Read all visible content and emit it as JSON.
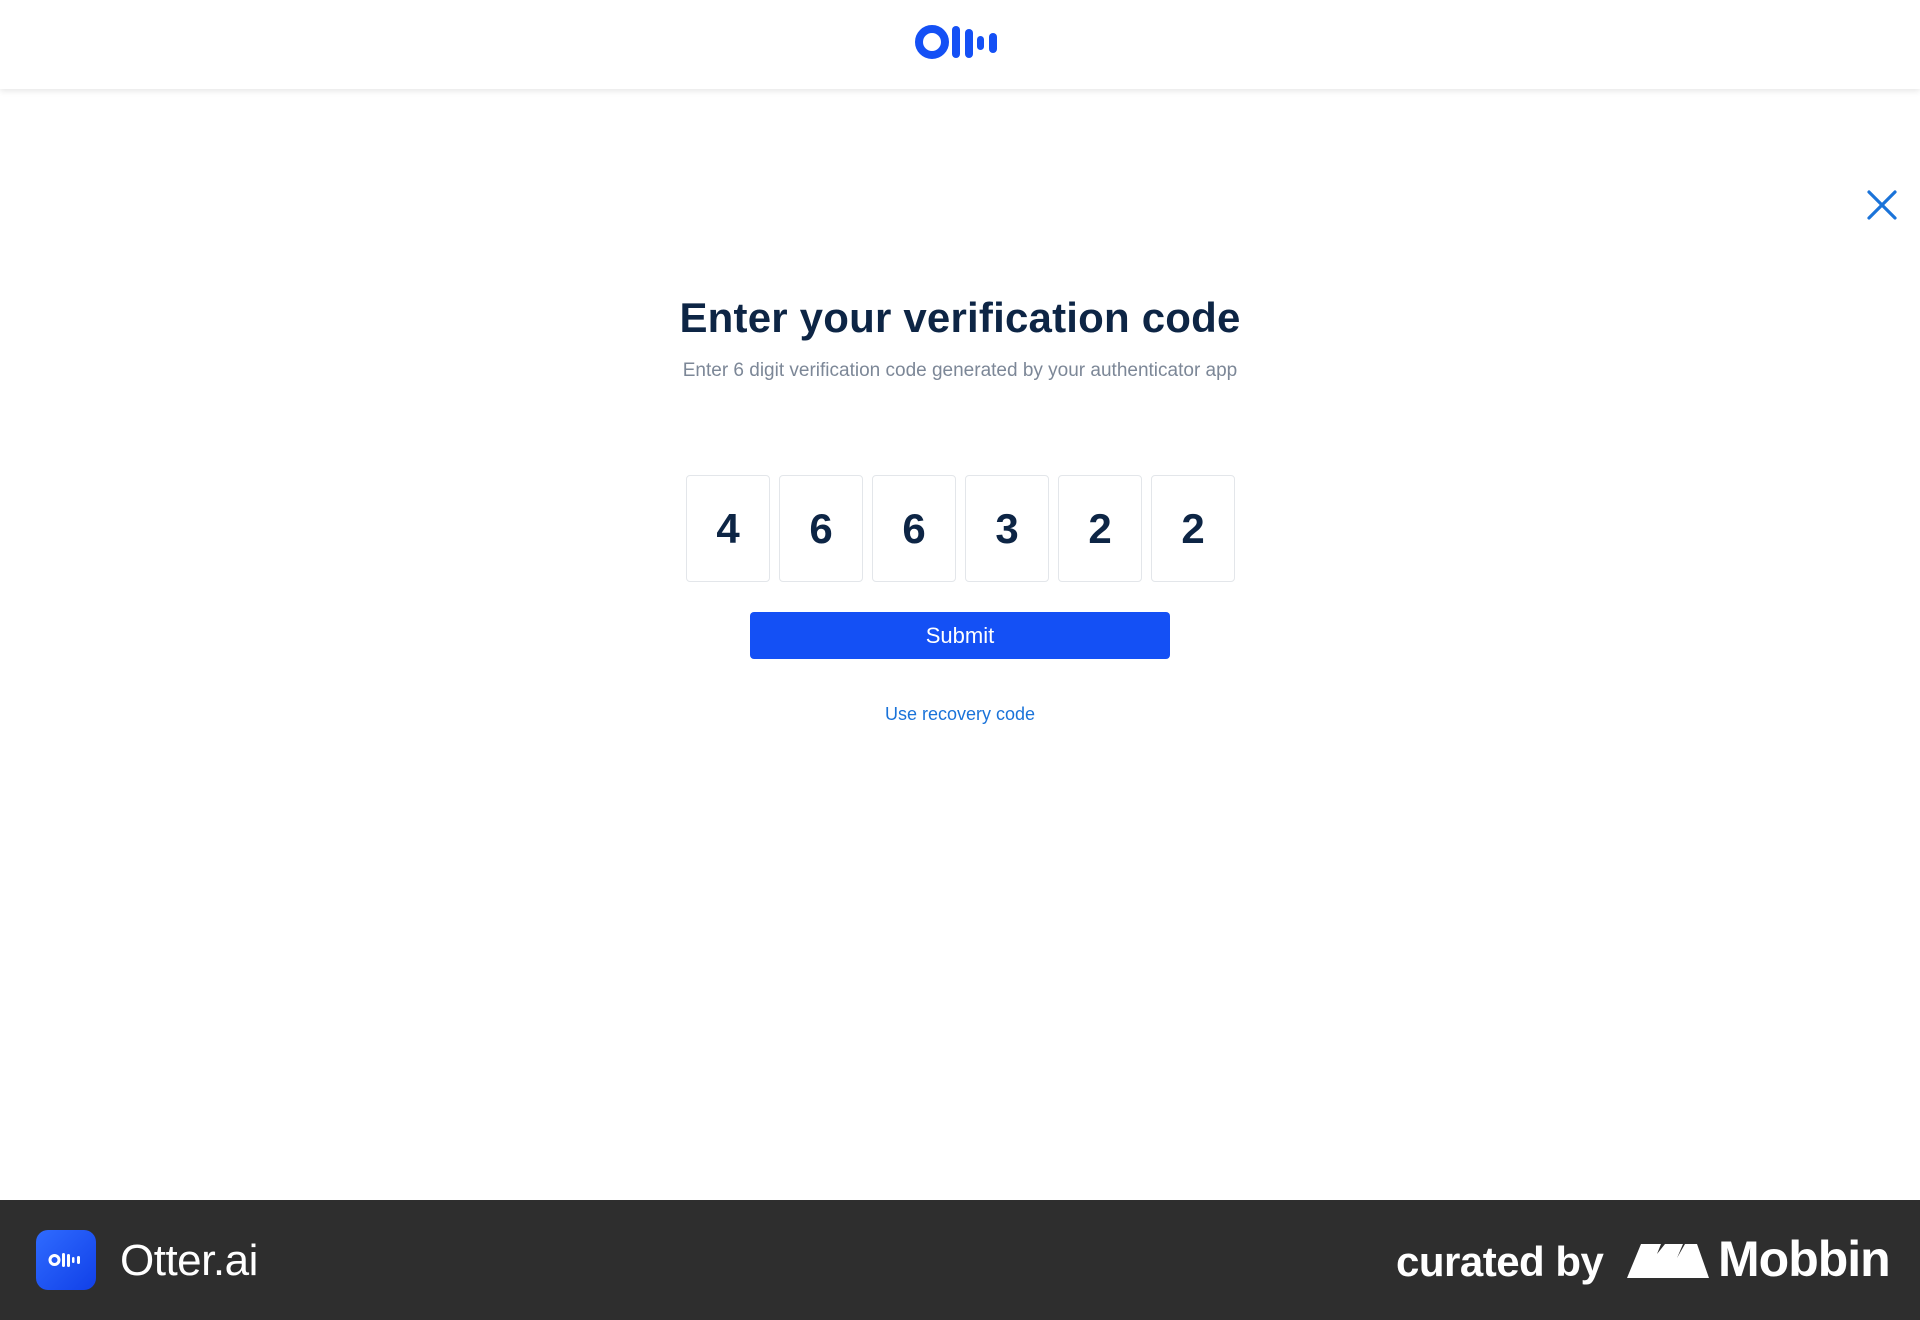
{
  "header": {
    "logo_icon": "otter-logo-icon",
    "brand_color": "#1450f5"
  },
  "dialog": {
    "close_icon": "close-icon",
    "title": "Enter your verification code",
    "subtitle": "Enter 6 digit verification code generated by your authenticator app",
    "code_digits": [
      "4",
      "6",
      "6",
      "3",
      "2",
      "2"
    ],
    "submit_label": "Submit",
    "recovery_link_label": "Use recovery code"
  },
  "footer": {
    "app_icon": "otter-app-icon",
    "app_name": "Otter.ai",
    "curated_label": "curated by",
    "mobbin_icon": "mobbin-logo-icon",
    "mobbin_name": "Mobbin"
  },
  "colors": {
    "title": "#0d2545",
    "subtitle": "#7c8797",
    "link": "#1a73d9",
    "button": "#1450f5",
    "footer_bg": "#2e2e2e"
  }
}
